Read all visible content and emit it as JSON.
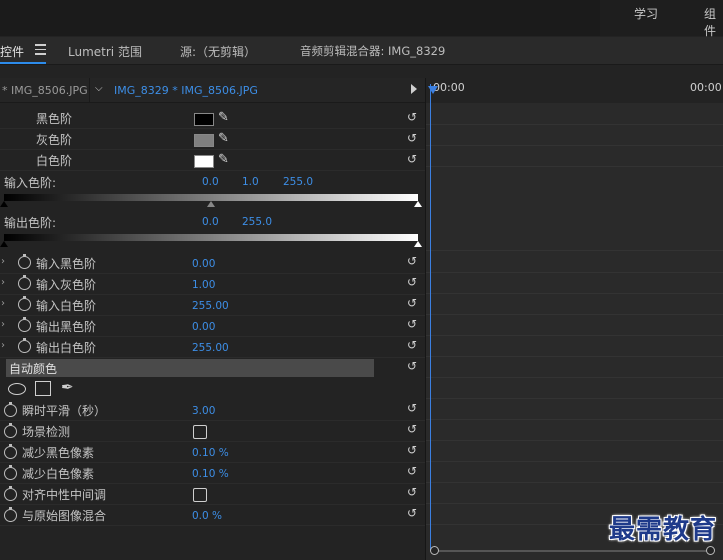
{
  "workspaces": [
    "学习",
    "组件"
  ],
  "panel_tabs": {
    "effect_controls": "控件",
    "lumetri_scopes": "Lumetri 范围",
    "source": "源:（无剪辑）",
    "audio_mixer": "音频剪辑混合器: IMG_8329"
  },
  "sequence": {
    "master_clip": "* IMG_8506.JPG",
    "active_clip": "IMG_8329 * IMG_8506.JPG"
  },
  "timeline": {
    "start_time": "00:00",
    "end_time": "00:00"
  },
  "levels": {
    "black": "黑色阶",
    "gray": "灰色阶",
    "white": "白色阶",
    "input_label": "输入色阶:",
    "input_values": [
      "0.0",
      "1.0",
      "255.0"
    ],
    "output_label": "输出色阶:",
    "output_values": [
      "0.0",
      "255.0"
    ]
  },
  "params": [
    {
      "label": "输入黑色阶",
      "value": "0.00"
    },
    {
      "label": "输入灰色阶",
      "value": "1.00"
    },
    {
      "label": "输入白色阶",
      "value": "255.00"
    },
    {
      "label": "输出黑色阶",
      "value": "0.00"
    },
    {
      "label": "输出白色阶",
      "value": "255.00"
    }
  ],
  "auto_color": {
    "title": "自动颜色",
    "params": [
      {
        "label": "瞬时平滑（秒）",
        "value": "3.00"
      },
      {
        "label": "场景检测",
        "value": ""
      },
      {
        "label": "减少黑色像素",
        "value": "0.10 %"
      },
      {
        "label": "减少白色像素",
        "value": "0.10 %"
      },
      {
        "label": "对齐中性中间调",
        "value": ""
      },
      {
        "label": "与原始图像混合",
        "value": "0.0 %"
      }
    ]
  },
  "colors": {
    "accent": "#3d8ee6",
    "playhead": "#3b7fe0",
    "panel": "#232323"
  },
  "watermark": "最需教育"
}
